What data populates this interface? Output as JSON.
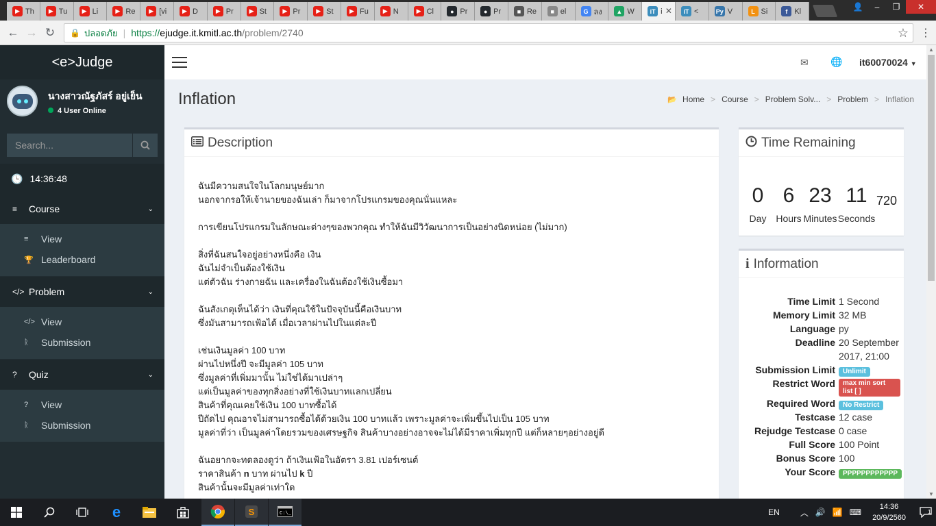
{
  "browser": {
    "tabs": [
      {
        "title": "Th",
        "color": "#e62117",
        "glyph": "▶"
      },
      {
        "title": "Tu",
        "color": "#e62117",
        "glyph": "▶"
      },
      {
        "title": "Li",
        "color": "#e62117",
        "glyph": "▶"
      },
      {
        "title": "Re",
        "color": "#e62117",
        "glyph": "▶"
      },
      {
        "title": "[vi",
        "color": "#e62117",
        "glyph": "▶"
      },
      {
        "title": "D",
        "color": "#e62117",
        "glyph": "▶"
      },
      {
        "title": "Pr",
        "color": "#e62117",
        "glyph": "▶"
      },
      {
        "title": "St",
        "color": "#e62117",
        "glyph": "▶"
      },
      {
        "title": "Pr",
        "color": "#e62117",
        "glyph": "▶"
      },
      {
        "title": "St",
        "color": "#e62117",
        "glyph": "▶"
      },
      {
        "title": "Fu",
        "color": "#e62117",
        "glyph": "▶"
      },
      {
        "title": "N",
        "color": "#e62117",
        "glyph": "▶"
      },
      {
        "title": "Cl",
        "color": "#e62117",
        "glyph": "▶"
      },
      {
        "title": "Pr",
        "color": "#24292e",
        "glyph": "●"
      },
      {
        "title": "Pr",
        "color": "#24292e",
        "glyph": "●"
      },
      {
        "title": "Re",
        "color": "#555555",
        "glyph": "■"
      },
      {
        "title": "el",
        "color": "#888888",
        "glyph": "■"
      },
      {
        "title": "ลง",
        "color": "#4285f4",
        "glyph": "G"
      },
      {
        "title": "W",
        "color": "#1fa463",
        "glyph": "▲"
      },
      {
        "title": "i",
        "color": "#3c8dbc",
        "glyph": "iT",
        "active": true
      },
      {
        "title": "<",
        "color": "#3c8dbc",
        "glyph": "iT"
      },
      {
        "title": "V",
        "color": "#3776ab",
        "glyph": "Py"
      },
      {
        "title": "Si",
        "color": "#f29111",
        "glyph": "L"
      },
      {
        "title": "Kl",
        "color": "#3b5998",
        "glyph": "f"
      }
    ],
    "secure_label": "ปลอดภัย",
    "url_scheme": "https://",
    "url_host": "ejudge.it.kmitl.ac.th",
    "url_path": "/problem/2740"
  },
  "sidebar": {
    "brand": "<e>Judge",
    "user_name": "นางสาวณัฐภัสร์ อยู่เย็น",
    "online": "4 User Online",
    "search_placeholder": "Search...",
    "clock": "14:36:48",
    "sections": [
      {
        "label": "Course",
        "icon": "≡",
        "items": [
          {
            "label": "View",
            "icon": "≡"
          },
          {
            "label": "Leaderboard",
            "icon": "🏆"
          }
        ]
      },
      {
        "label": "Problem",
        "icon": "</>",
        "items": [
          {
            "label": "View",
            "icon": "</>"
          },
          {
            "label": "Submission",
            "icon": "ᚱ"
          }
        ]
      },
      {
        "label": "Quiz",
        "icon": "?",
        "items": [
          {
            "label": "View",
            "icon": "?"
          },
          {
            "label": "Submission",
            "icon": "ᚱ"
          }
        ]
      }
    ]
  },
  "topnav": {
    "account": "it60070024"
  },
  "page": {
    "title": "Inflation",
    "breadcrumb": [
      "Home",
      "Course",
      "Problem Solv...",
      "Problem",
      "Inflation"
    ]
  },
  "description": {
    "heading": "Description",
    "paragraphs": [
      [
        "ฉันมีความสนใจในโลกมนุษย์มาก",
        "นอกจากรอให้เจ้านายของฉันเล่า ก็มาจากโปรแกรมของคุณนั่นแหละ"
      ],
      [
        "การเขียนโปรแกรมในลักษณะต่างๆของพวกคุณ ทำให้ฉันมีวิวัฒนาการเป็นอย่างนิดหน่อย (ไม่มาก)"
      ],
      [
        "สิ่งที่ฉันสนใจอยู่อย่างหนึ่งคือ เงิน",
        "ฉันไม่จำเป็นต้องใช้เงิน",
        "แต่ตัวฉัน ร่างกายฉัน และเครื่องในฉันต้องใช้เงินซื้อมา"
      ],
      [
        "ฉันสังเกตุเห็นได้ว่า เงินที่คุณใช้ในปัจจุบันนี้คือเงินบาท",
        "ซึ่งมันสามารถเฟ้อได้ เมื่อเวลาผ่านไปในแต่ละปี"
      ],
      [
        "เช่นเงินมูลค่า 100 บาท",
        "ผ่านไปหนึ่งปี จะมีมูลค่า 105 บาท",
        "ซึ่งมูลค่าที่เพิ่มมานั้น ไม่ใช่ได้มาเปล่าๆ",
        "แต่เป็นมูลค่าของทุกสิ่งอย่างที่ใช้เงินบาทแลกเปลี่ยน",
        "สินค้าที่คุณเคยใช้เงิน 100 บาทซื้อได้",
        "ปีถัดไป คุณอาจไม่สามารถซื้อได้ด้วยเงิน 100 บาทแล้ว เพราะมูลค่าจะเพิ่มขึ้นไปเป็น 105 บาท",
        "มูลค่าที่ว่า เป็นมูลค่าโดยรวมของเศรษฐกิจ สินค้าบางอย่างอาจจะไม่ได้มีราคาเพิ่มทุกปี แต่ก็หลายๆอย่างอยู่ดี"
      ]
    ],
    "last_line1": "ฉันอยากจะทดลองดูว่า ถ้าเงินเฟ้อในอัตรา 3.81 เปอร์เซนต์",
    "last_line2_a": "ราคาสินค้า ",
    "last_line2_b": "n",
    "last_line2_c": " บาท ผ่านไป ",
    "last_line2_d": "k",
    "last_line2_e": " ปี",
    "last_line3": "สินค้านั้นจะมีมูลค่าเท่าใด"
  },
  "time_remaining": {
    "heading": "Time Remaining",
    "day": "0",
    "hours": "6",
    "minutes": "23",
    "seconds": "11",
    "ms": "720",
    "day_label": "Day",
    "hours_label": "Hours",
    "minutes_label": "Minutes",
    "seconds_label": "Seconds"
  },
  "information": {
    "heading": "Information",
    "rows": [
      {
        "k": "Time Limit",
        "v": "1 Second"
      },
      {
        "k": "Memory Limit",
        "v": "32 MB"
      },
      {
        "k": "Language",
        "v": "py"
      },
      {
        "k": "Deadline",
        "v": "20 September 2017, 21:00"
      },
      {
        "k": "Submission Limit",
        "badge": "Unlimit",
        "badge_type": "b-info"
      },
      {
        "k": "Restrict Word",
        "badge": "max min sort list [ ]",
        "badge_type": "b-danger"
      },
      {
        "k": "Required Word",
        "badge": "No Restrict",
        "badge_type": "b-info"
      },
      {
        "k": "Testcase",
        "v": "12 case"
      },
      {
        "k": "Rejudge Testcase",
        "v": "0 case"
      },
      {
        "k": "Full Score",
        "v": "100 Point"
      },
      {
        "k": "Bonus Score",
        "v": "100"
      },
      {
        "k": "Your Score",
        "badge": "PPPPPPPPPPPP",
        "badge_type": "b-success"
      }
    ]
  },
  "taskbar": {
    "lang": "EN",
    "time": "14:36",
    "date": "20/9/2560",
    "notifications": "1"
  }
}
